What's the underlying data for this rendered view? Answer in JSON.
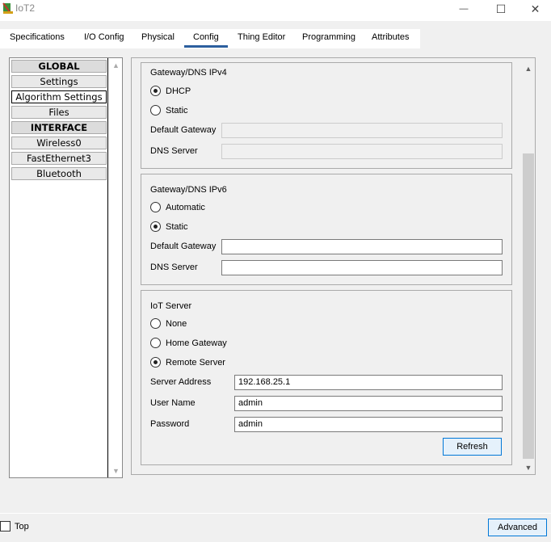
{
  "window": {
    "title": "IoT2",
    "minimize_glyph": "—",
    "maximize_glyph": "☐",
    "close_glyph": "✕"
  },
  "tabs": [
    {
      "label": "Specifications"
    },
    {
      "label": "I/O Config"
    },
    {
      "label": "Physical"
    },
    {
      "label": "Config"
    },
    {
      "label": "Thing Editor"
    },
    {
      "label": "Programming"
    },
    {
      "label": "Attributes"
    }
  ],
  "sidebar": {
    "items": [
      {
        "label": "GLOBAL"
      },
      {
        "label": "Settings"
      },
      {
        "label": "Algorithm Settings"
      },
      {
        "label": "Files"
      },
      {
        "label": "INTERFACE"
      },
      {
        "label": "Wireless0"
      },
      {
        "label": "FastEthernet3"
      },
      {
        "label": "Bluetooth"
      }
    ]
  },
  "ipv4": {
    "title": "Gateway/DNS IPv4",
    "option_dhcp": "DHCP",
    "option_static": "Static",
    "gateway_label": "Default Gateway",
    "gateway_value": "",
    "dns_label": "DNS Server",
    "dns_value": ""
  },
  "ipv6": {
    "title": "Gateway/DNS IPv6",
    "option_auto": "Automatic",
    "option_static": "Static",
    "gateway_label": "Default Gateway",
    "gateway_value": "",
    "dns_label": "DNS Server",
    "dns_value": ""
  },
  "iot_server": {
    "title": "IoT Server",
    "option_none": "None",
    "option_home": "Home Gateway",
    "option_remote": "Remote Server",
    "address_label": "Server Address",
    "address_value": "192.168.25.1",
    "user_label": "User Name",
    "user_value": "admin",
    "password_label": "Password",
    "password_value": "admin",
    "refresh_label": "Refresh"
  },
  "footer": {
    "top_label": "Top",
    "advanced_label": "Advanced"
  },
  "colors": {
    "accent": "#2c5f9e",
    "button_border": "#0078d7"
  }
}
